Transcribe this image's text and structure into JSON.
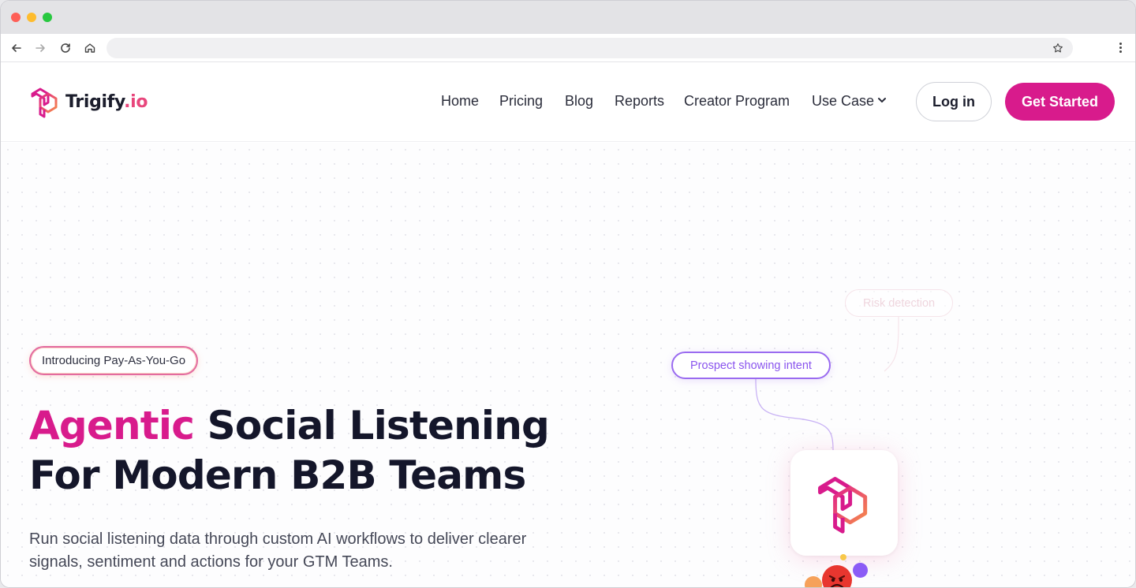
{
  "browser": {
    "back_icon": "arrow-left-icon",
    "forward_icon": "arrow-right-icon",
    "reload_icon": "reload-icon",
    "home_icon": "home-icon",
    "url": "",
    "bookmark_icon": "star-icon",
    "menu_icon": "kebab-icon"
  },
  "site": {
    "logo": {
      "name": "Trigify",
      "suffix": ".io"
    },
    "nav": {
      "items": [
        "Home",
        "Pricing",
        "Blog",
        "Reports",
        "Creator Program",
        "Use Case"
      ],
      "login_label": "Log in",
      "cta_label": "Get Started"
    },
    "colors": {
      "brand": "#d81b8c",
      "accent_purple": "#8a55ee",
      "text_dark": "#14162a"
    }
  },
  "hero": {
    "badge": "Introducing Pay-As-You-Go",
    "headline_accent": "Agentic",
    "headline_rest_1": " Social Listening",
    "headline_line_2": "For Modern B2B Teams",
    "subtext": "Run social listening data through custom AI workflows to deliver clearer signals, sentiment and actions for your GTM Teams."
  },
  "flow": {
    "intent_label": "Prospect showing intent",
    "risk_label": "Risk detection"
  }
}
